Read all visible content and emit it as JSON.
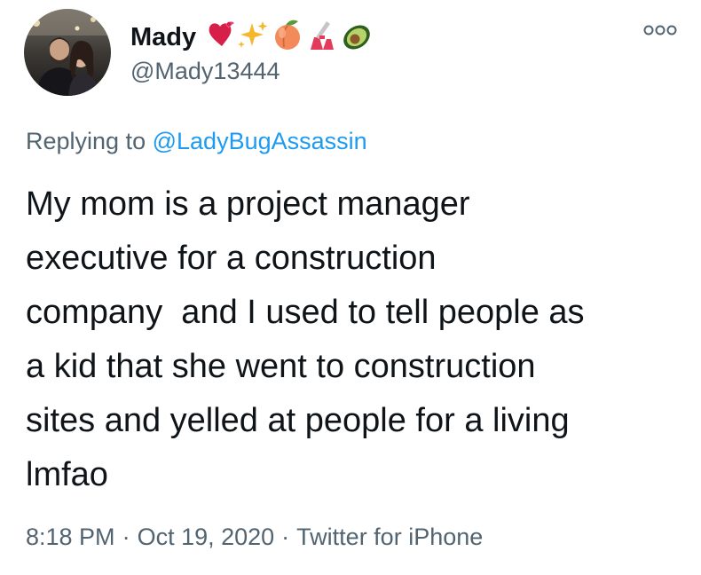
{
  "author": {
    "display_name": "Mady",
    "handle": "@Mady13444",
    "name_emojis": [
      "heart-icon",
      "sparkles-icon",
      "peach-icon",
      "nail-polish-icon",
      "avocado-icon"
    ]
  },
  "reply": {
    "prefix": "Replying to",
    "to_handle": "@LadyBugAssassin"
  },
  "tweet": {
    "lines": [
      "My mom is a project manager",
      "executive for a construction",
      "company  and I used to tell people as",
      "a kid that she went to construction",
      "sites and yelled at people for a living",
      "lmfao"
    ]
  },
  "meta": {
    "time": "8:18 PM",
    "separator": "·",
    "date": "Oct 19, 2020",
    "source": "Twitter for iPhone"
  },
  "colors": {
    "text_primary": "#0f1419",
    "text_secondary": "#536471",
    "link": "#1d9bf0"
  }
}
